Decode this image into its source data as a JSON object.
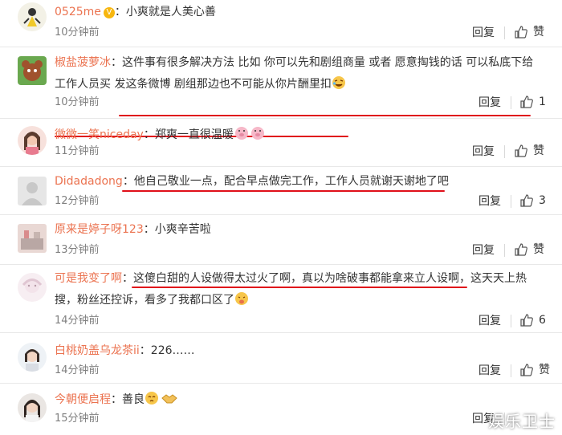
{
  "comments": [
    {
      "username": "0525me",
      "text": "小爽就是人美心善",
      "time": "10分钟前",
      "reply_label": "回复",
      "like_label": "赞"
    },
    {
      "username": "椒盐菠萝冰",
      "text": "这件事有很多解决方法 比如 你可以先和剧组商量 或者 愿意掏钱的话 可以私底下给",
      "text2": "工作人员买 发这条微博 剧组那边也不可能从你片酬里扣",
      "time": "10分钟前",
      "reply_label": "回复",
      "like_count": "1"
    },
    {
      "username": "微微一笑niceday",
      "text": "郑爽一直很温暖",
      "time": "11分钟前",
      "reply_label": "回复",
      "like_label": "赞"
    },
    {
      "username": "Didadadong",
      "text": "他自己敬业一点，配合早点做完工作，工作人员就谢天谢地了吧",
      "time": "12分钟前",
      "reply_label": "回复",
      "like_count": "3"
    },
    {
      "username": "原来是婷子呀123",
      "text": "小爽辛苦啦",
      "time": "13分钟前",
      "reply_label": "回复",
      "like_label": "赞"
    },
    {
      "username": "可是我变了啊",
      "text": "这傻白甜的人设做得太过火了啊，真以为啥破事都能拿来立人设啊，这天天上热",
      "text2": "搜，粉丝还控诉，看多了我都口区了",
      "time": "14分钟前",
      "reply_label": "回复",
      "like_count": "6"
    },
    {
      "username": "白桃奶盖乌龙茶ii",
      "text": "226……",
      "time": "14分钟前",
      "reply_label": "回复",
      "like_label": "赞"
    },
    {
      "username": "今朝便启程",
      "text": "善良",
      "time": "15分钟前",
      "reply_label": "回复",
      "like_label": "赞"
    }
  ],
  "colon": "：",
  "watermark": "娱乐卫士",
  "colors": {
    "username": "#eb7350",
    "underline": "#e0101a",
    "muted": "#808080"
  },
  "icons": {
    "like": "thumbs-up-icon",
    "verified": "verified-v-badge",
    "emoji": "cry-laugh-emoji"
  }
}
